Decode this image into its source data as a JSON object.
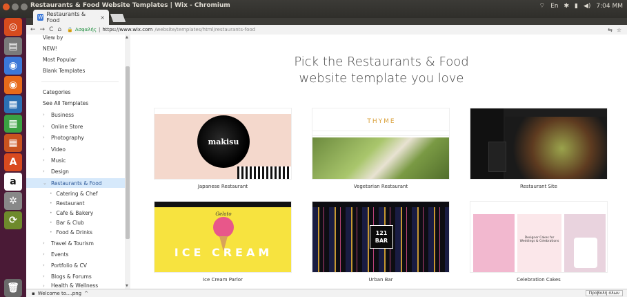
{
  "window": {
    "title": "Restaurants & Food Website Templates | Wix - Chromium",
    "time": "7:04 ΜΜ",
    "lang": "En"
  },
  "tab": {
    "label": "Restaurants & Food",
    "close": "×"
  },
  "toolbar": {
    "secure_label": "Ασφαλής",
    "url_host": "https://www.wix.com",
    "url_path": "/website/templates/html/restaurants-food"
  },
  "sidebar": {
    "top_items": [
      "View by",
      "NEW!",
      "Most Popular",
      "Blank Templates"
    ],
    "categories_heading": "Categories",
    "see_all": "See All Templates",
    "categories": [
      {
        "label": "Business"
      },
      {
        "label": "Online Store"
      },
      {
        "label": "Photography"
      },
      {
        "label": "Video"
      },
      {
        "label": "Music"
      },
      {
        "label": "Design"
      },
      {
        "label": "Restaurants & Food",
        "active": true
      }
    ],
    "subcategories": [
      "Catering & Chef",
      "Restaurant",
      "Cafe & Bakery",
      "Bar & Club",
      "Food & Drinks"
    ],
    "more_categories": [
      "Travel & Tourism",
      "Events",
      "Portfolio & CV",
      "Blogs & Forums",
      "Health & Wellness"
    ]
  },
  "main": {
    "heading_line1": "Pick the Restaurants & Food",
    "heading_line2": "website template you love"
  },
  "templates": [
    {
      "name": "Japanese Restaurant",
      "logo": "makisu"
    },
    {
      "name": "Vegetarian Restaurant",
      "logo": "THYME"
    },
    {
      "name": "Restaurant Site",
      "logo": ""
    },
    {
      "name": "Ice Cream Parlor",
      "logo": "Gelato",
      "banner": "ICE CREAM"
    },
    {
      "name": "Urban Bar",
      "logo": "121 BAR"
    },
    {
      "name": "Celebration Cakes",
      "logo": "",
      "banner": "Designer Cakes for Weddings & Celebrations"
    }
  ],
  "download_bar": {
    "item": "Welcome to....png",
    "show_all": "Προβολή όλων"
  },
  "colors": {
    "launcher": "#4a1a36",
    "active_category_bg": "#d6e9fb",
    "accent_orange": "#e05a26"
  }
}
